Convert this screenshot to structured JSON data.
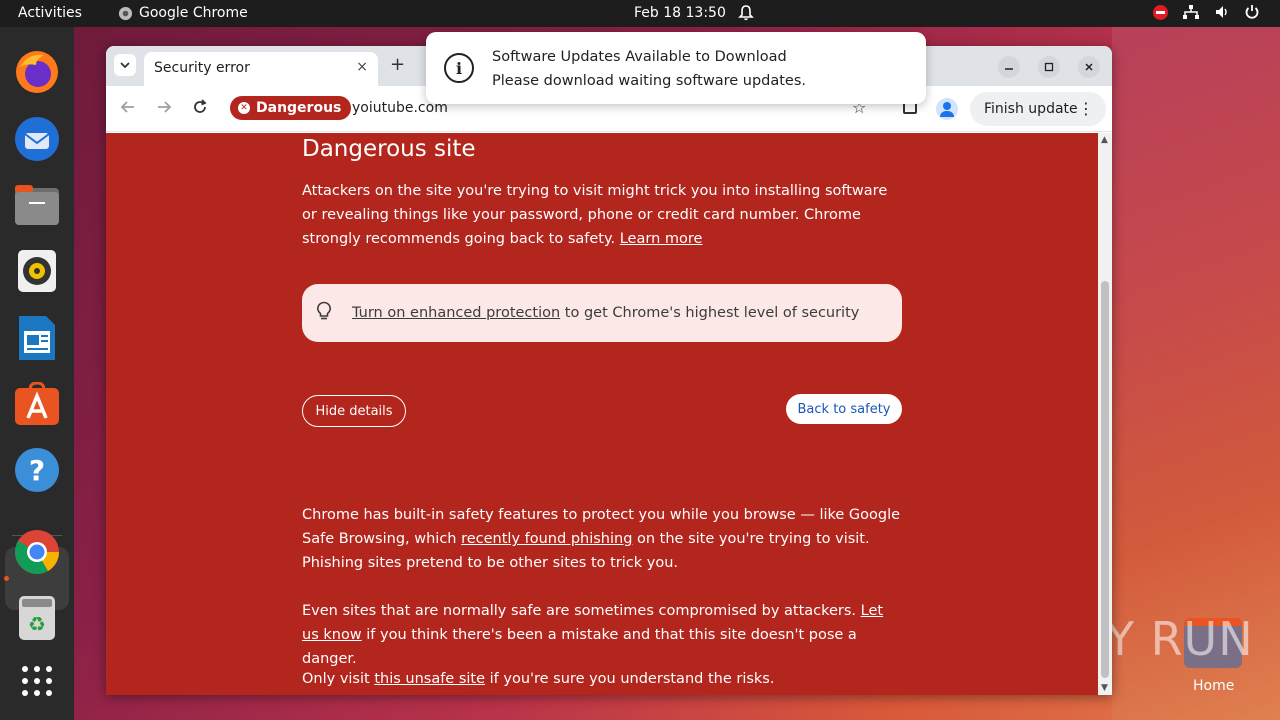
{
  "topbar": {
    "activities": "Activities",
    "app_name": "Google Chrome",
    "clock": "Feb 18  13:50"
  },
  "dock": {
    "items": [
      "firefox-icon",
      "thunderbird-icon",
      "files-icon",
      "rhythmbox-icon",
      "writer-icon",
      "app-center-icon",
      "help-icon",
      "chrome-icon",
      "trash-icon",
      "apps-grid-icon"
    ]
  },
  "desktop": {
    "home_label": "Home",
    "watermark": "ANY RUN"
  },
  "notification": {
    "title": "Software Updates Available to Download",
    "body": "Please download waiting software updates."
  },
  "browser": {
    "tab_title": "Security error",
    "tab_close": "×",
    "new_tab": "+",
    "badge": "Dangerous",
    "url": "yoiutube.com",
    "finish_update": "Finish update"
  },
  "page": {
    "heading": "Dangerous site",
    "intro": "Attackers on the site you're trying to visit might trick you into installing software or revealing things like your password, phone or credit card number. Chrome strongly recommends going back to safety.",
    "learn_more": "Learn more",
    "protection_link": "Turn on enhanced protection",
    "protection_rest": " to get Chrome's highest level of security",
    "hide_details": "Hide details",
    "back_to_safety": "Back to safety",
    "details1_a": "Chrome has built-in safety features to protect you while you browse — like Google Safe Browsing, which ",
    "details1_link": "recently found phishing",
    "details1_b": " on the site you're trying to visit. Phishing sites pretend to be other sites to trick you.",
    "details2_a": "Even sites that are normally safe are sometimes compromised by attackers. ",
    "details2_link": "Let us know",
    "details2_b": " if you think there's been a mistake and that this site doesn't pose a danger.",
    "details3_a": "Only visit ",
    "details3_link": "this unsafe site",
    "details3_b": " if you're sure you understand the risks."
  },
  "colors": {
    "danger_bg": "#b3261e",
    "accent_orange": "#e95420"
  }
}
